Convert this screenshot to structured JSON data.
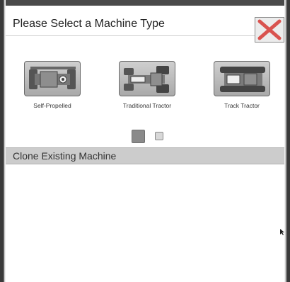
{
  "dialog": {
    "title": "Please Select a Machine Type",
    "close_icon": "close-x-icon"
  },
  "machines": [
    {
      "label": "Self-Propelled",
      "icon": "self-propelled-icon"
    },
    {
      "label": "Traditional Tractor",
      "icon": "traditional-tractor-icon"
    },
    {
      "label": "Track Tractor",
      "icon": "track-tractor-icon"
    }
  ],
  "pager": {
    "current_page": 1,
    "total_pages": 2
  },
  "clone": {
    "label": "Clone Existing Machine"
  },
  "colors": {
    "close_x": "#d9534f",
    "section_bar": "#cccccc",
    "border": "#3a3a3a"
  }
}
